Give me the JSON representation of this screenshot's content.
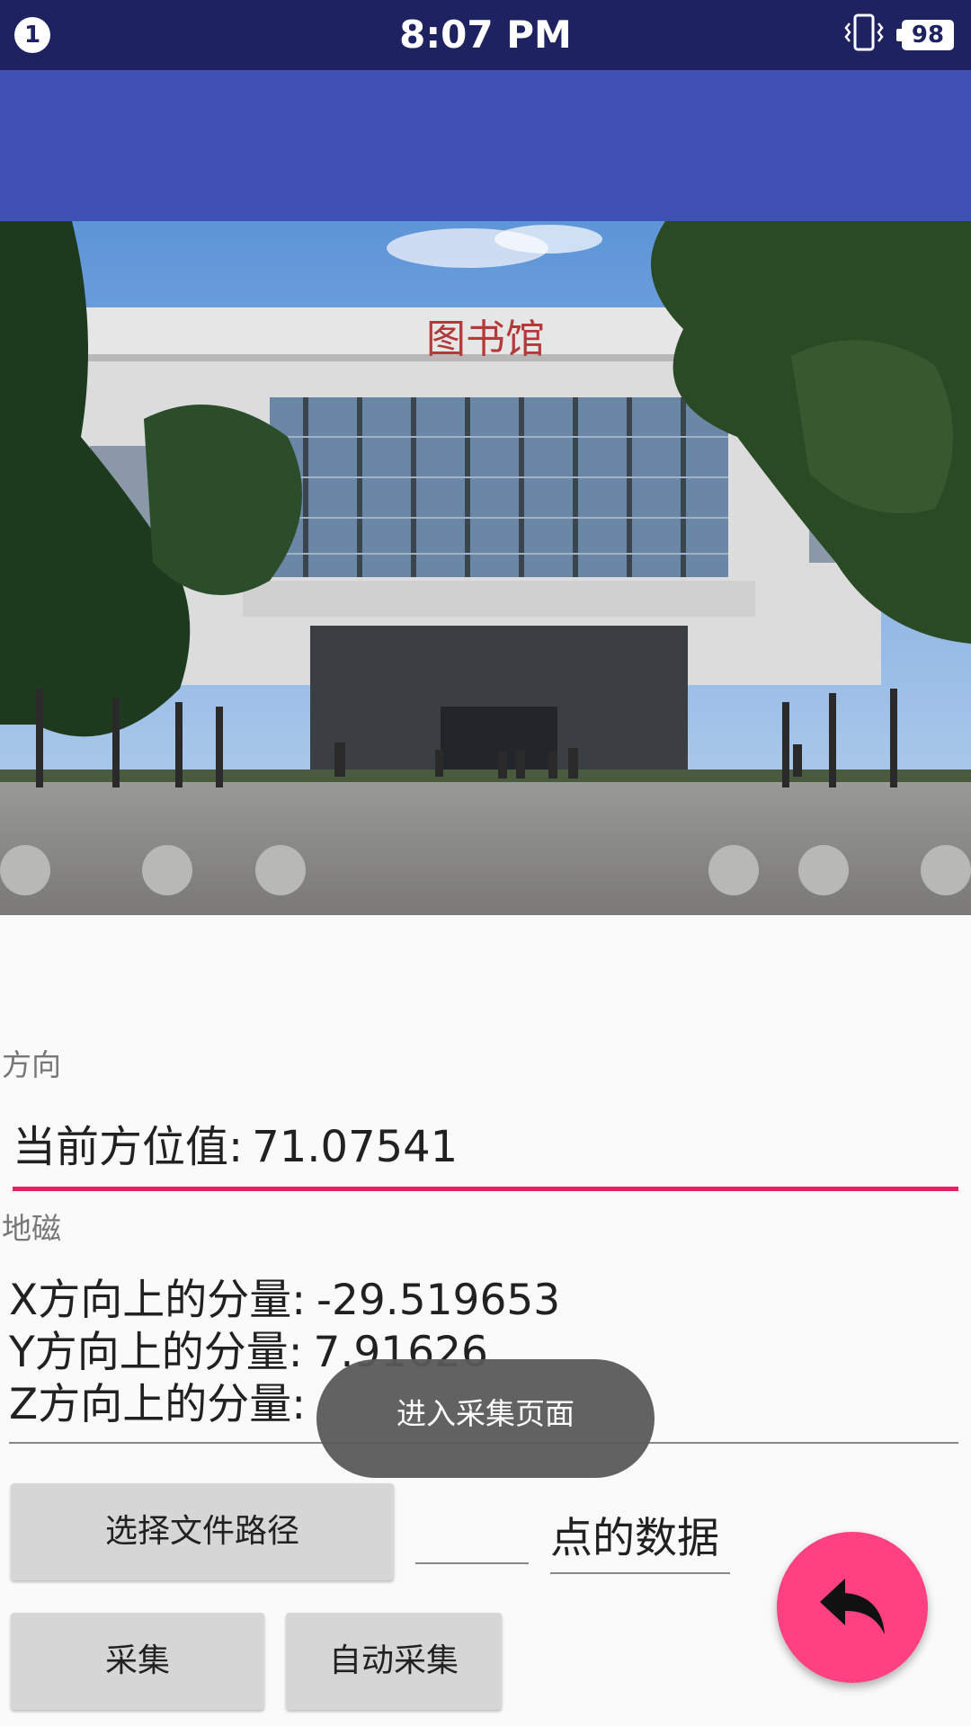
{
  "status_bar": {
    "notification_count": "1",
    "time": "8:07 PM",
    "battery_level": "98",
    "icons": [
      "vibrate-icon",
      "battery-icon"
    ]
  },
  "photo": {
    "signage_text": "图书馆"
  },
  "direction": {
    "section_label": "方向",
    "azimuth_label": "当前方位值:",
    "azimuth_value": "71.07541"
  },
  "magnetic": {
    "section_label": "地磁",
    "x_label": "X方向上的分量:",
    "x_value": "-29.519653",
    "y_label": "Y方向上的分量:",
    "y_value": "7.91626",
    "z_label": "Z方向上的分量:",
    "z_value": ""
  },
  "toast": {
    "message": "进入采集页面"
  },
  "controls": {
    "select_path_label": "选择文件路径",
    "point_number_value": "",
    "point_data_label": "点的数据",
    "collect_label": "采集",
    "auto_collect_label": "自动采集"
  },
  "fab": {
    "icon": "reply-arrow-icon",
    "color": "#ff4081"
  },
  "colors": {
    "status_bar": "#1f2260",
    "app_bar": "#3f51b5",
    "accent_underline": "#e91e63"
  }
}
